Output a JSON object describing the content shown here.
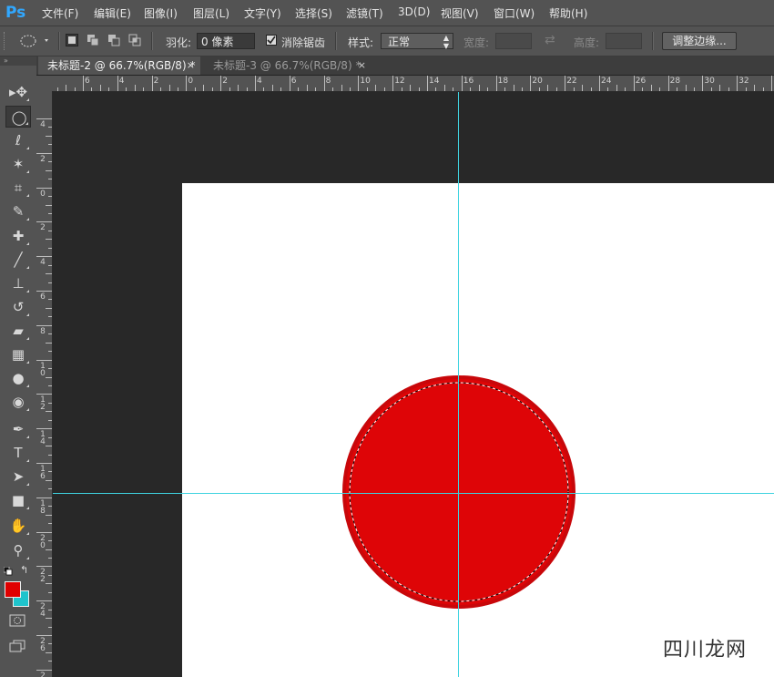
{
  "app": {
    "logo": "Ps"
  },
  "menu": [
    "文件(F)",
    "编辑(E)",
    "图像(I)",
    "图层(L)",
    "文字(Y)",
    "选择(S)",
    "滤镜(T)",
    "3D(D)",
    "视图(V)",
    "窗口(W)",
    "帮助(H)"
  ],
  "options": {
    "tool_icon": "ellipse-marquee-icon",
    "feather_label": "羽化:",
    "feather_value": "0 像素",
    "antialias_label": "消除锯齿",
    "antialias_checked": true,
    "style_label": "样式:",
    "style_value": "正常",
    "width_label": "宽度:",
    "height_label": "高度:",
    "refine_edge_button": "调整边缘..."
  },
  "tabs": [
    {
      "label": "未标题-2 @ 66.7%(RGB/8) *",
      "active": true
    },
    {
      "label": "未标题-3 @ 66.7%(RGB/8) *",
      "active": false
    }
  ],
  "tools": [
    {
      "name": "move-tool",
      "icon": "move-icon",
      "glyph": "▸✥"
    },
    {
      "name": "elliptical-marquee-tool",
      "icon": "ellipse-marquee-icon",
      "glyph": "◯",
      "selected": true
    },
    {
      "name": "lasso-tool",
      "icon": "lasso-icon",
      "glyph": "ℓ"
    },
    {
      "name": "magic-wand-tool",
      "icon": "magic-wand-icon",
      "glyph": "✶"
    },
    {
      "name": "crop-tool",
      "icon": "crop-icon",
      "glyph": "⌗"
    },
    {
      "name": "eyedropper-tool",
      "icon": "eyedropper-icon",
      "glyph": "✎"
    },
    {
      "name": "healing-brush-tool",
      "icon": "bandage-icon",
      "glyph": "✚"
    },
    {
      "name": "brush-tool",
      "icon": "brush-icon",
      "glyph": "╱"
    },
    {
      "name": "clone-stamp-tool",
      "icon": "stamp-icon",
      "glyph": "⊥"
    },
    {
      "name": "history-brush-tool",
      "icon": "history-brush-icon",
      "glyph": "↺"
    },
    {
      "name": "eraser-tool",
      "icon": "eraser-icon",
      "glyph": "▰"
    },
    {
      "name": "gradient-tool",
      "icon": "gradient-icon",
      "glyph": "▦"
    },
    {
      "name": "blur-tool",
      "icon": "drop-icon",
      "glyph": "●"
    },
    {
      "name": "dodge-tool",
      "icon": "dodge-icon",
      "glyph": "◉"
    },
    {
      "name": "pen-tool",
      "icon": "pen-icon",
      "glyph": "✒"
    },
    {
      "name": "type-tool",
      "icon": "type-icon",
      "glyph": "T"
    },
    {
      "name": "path-selection-tool",
      "icon": "arrow-icon",
      "glyph": "➤"
    },
    {
      "name": "rectangle-tool",
      "icon": "rectangle-icon",
      "glyph": "■"
    },
    {
      "name": "hand-tool",
      "icon": "hand-icon",
      "glyph": "✋"
    },
    {
      "name": "zoom-tool",
      "icon": "zoom-icon",
      "glyph": "⚲"
    }
  ],
  "colors": {
    "foreground": "#e00000",
    "background": "#1fc4cc",
    "circle_fill": "#de0507",
    "circle_stroke": "#c8070a",
    "guide": "#3fd3e0",
    "canvas": "#ffffff",
    "workspace": "#282828"
  },
  "ruler": {
    "h_labels": [
      "6",
      "4",
      "2",
      "0",
      "2",
      "4",
      "6",
      "8",
      "10",
      "12",
      "14",
      "16",
      "18",
      "20",
      "22",
      "24",
      "26",
      "28",
      "30",
      "32"
    ],
    "v_labels": [
      "4",
      "2",
      "0",
      "2",
      "4",
      "6",
      "8",
      "10",
      "12",
      "14",
      "16",
      "18",
      "20",
      "22",
      "24",
      "26",
      "28"
    ]
  },
  "watermark": "四川龙网"
}
